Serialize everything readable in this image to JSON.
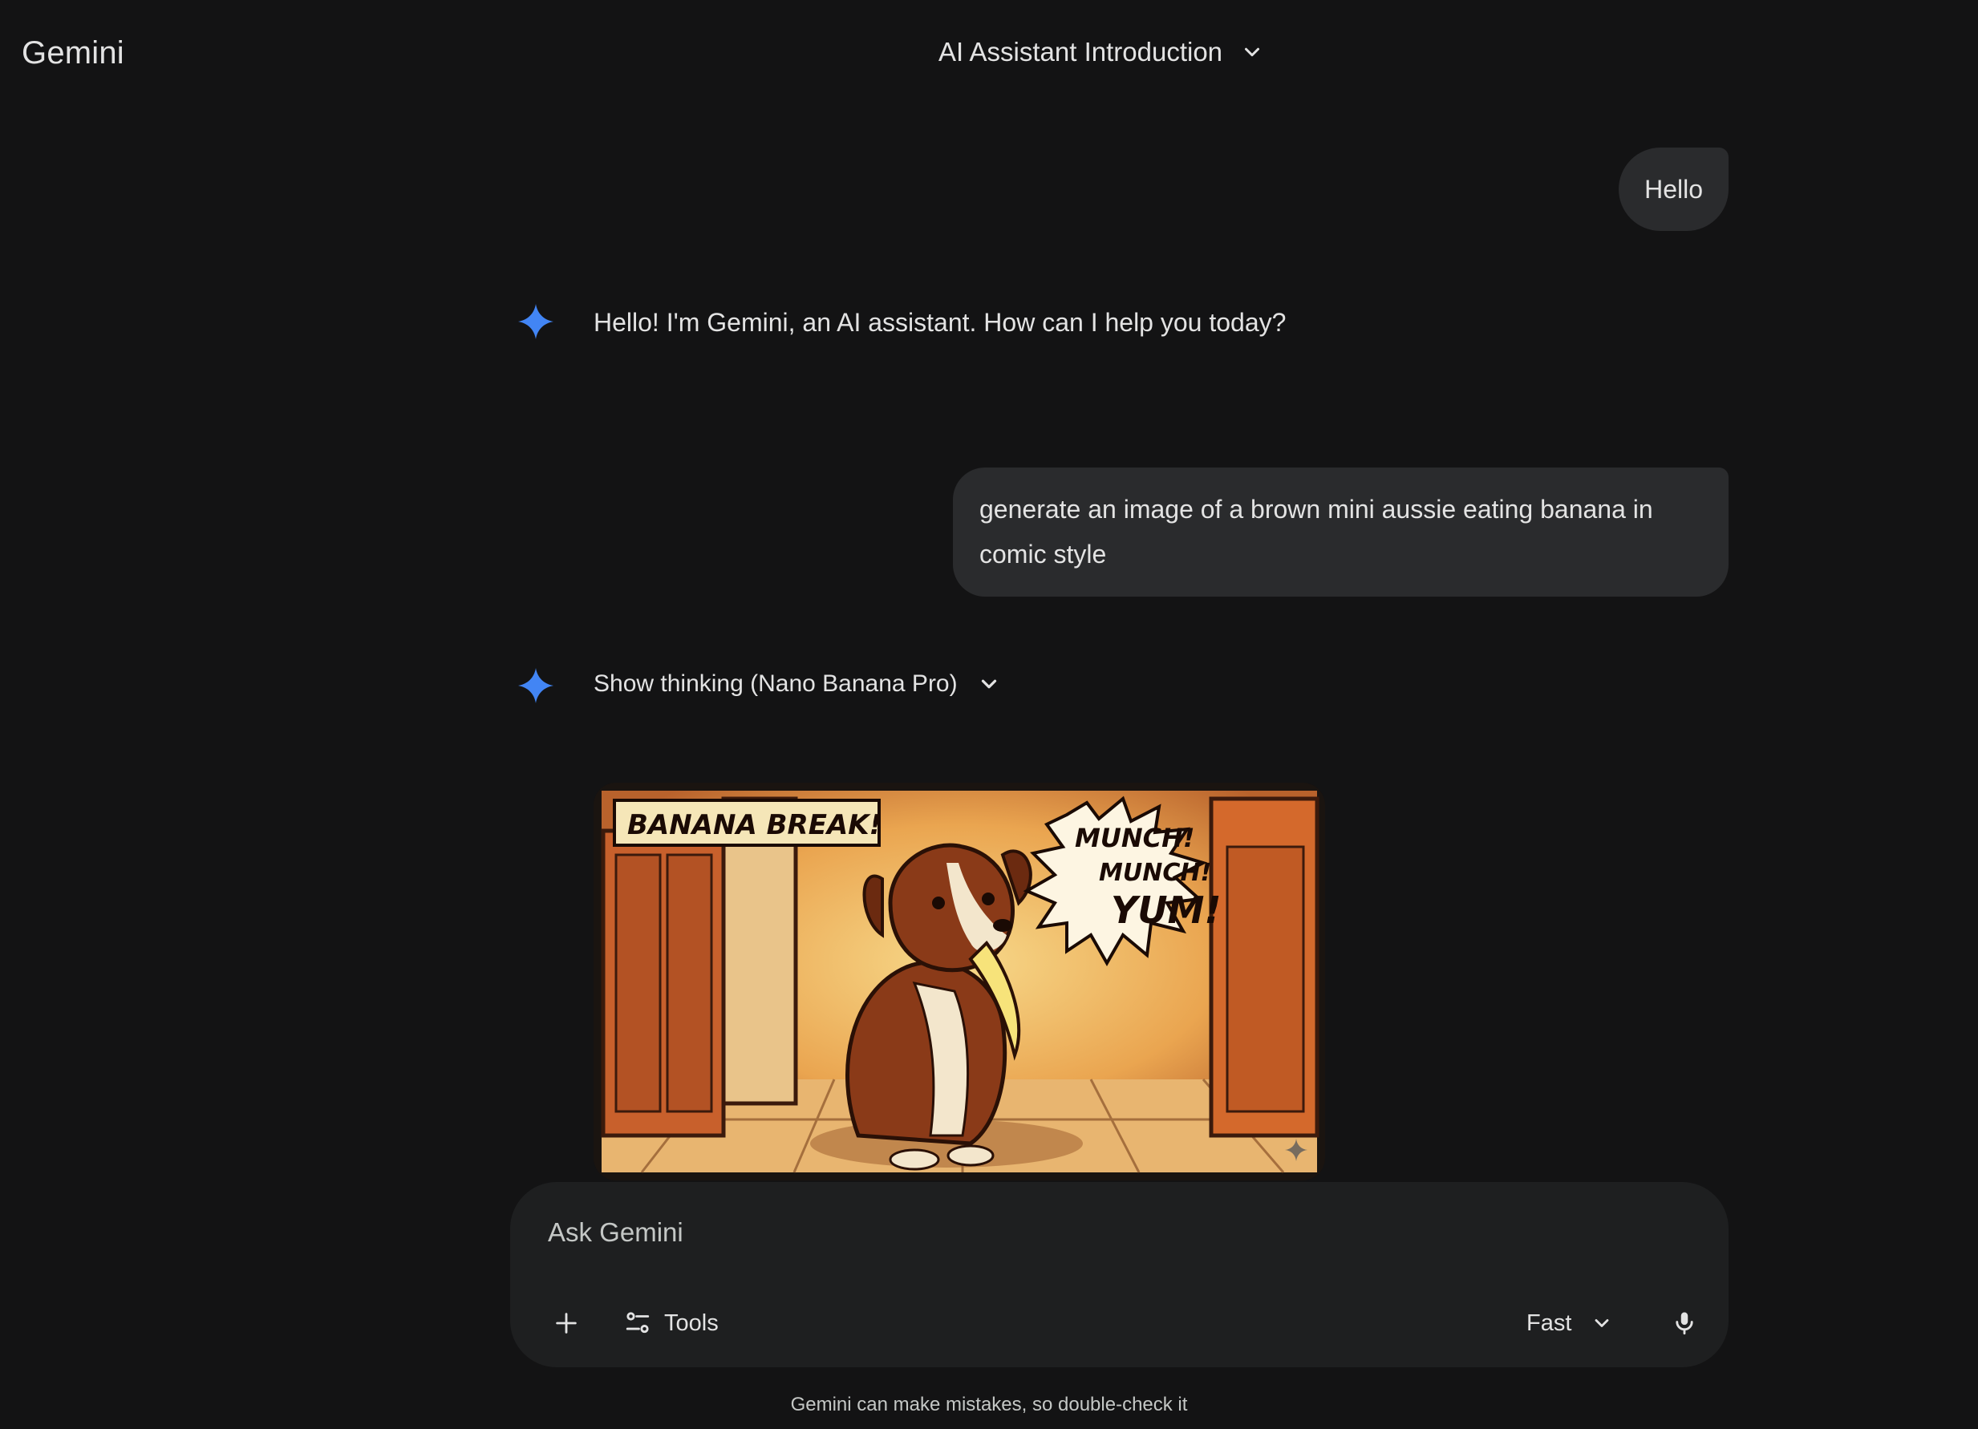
{
  "app": {
    "title": "Gemini"
  },
  "header": {
    "conversation_title": "AI Assistant Introduction"
  },
  "conversation": {
    "turns": [
      {
        "role": "user",
        "text": "Hello"
      },
      {
        "role": "model",
        "text": "Hello! I'm Gemini, an AI assistant. How can I help you today?"
      },
      {
        "role": "user",
        "text": "generate an image of a brown mini aussie eating banana in comic style"
      },
      {
        "role": "model",
        "thinking_label": "Show thinking (Nano Banana Pro)"
      }
    ],
    "image_text": {
      "caption_box": "BANANA BREAK!",
      "burst_1": "MUNCH!",
      "burst_2": "MUNCH!",
      "burst_3": "YUM!"
    }
  },
  "composer": {
    "placeholder": "Ask Gemini",
    "tools_label": "Tools",
    "model_label": "Fast"
  },
  "footer": {
    "disclaimer": "Gemini can make mistakes, so double-check it"
  },
  "colors": {
    "background": "#131314",
    "bubble": "#2a2b2d",
    "composer": "#1e1f20",
    "spark_blue": "#4285f4"
  },
  "icons": [
    "chevron-down-icon",
    "gemini-spark-icon",
    "plus-icon",
    "tools-icon",
    "mic-icon"
  ]
}
